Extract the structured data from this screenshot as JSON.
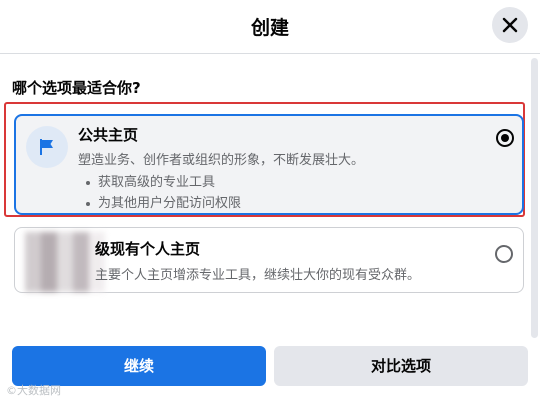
{
  "dialog": {
    "title": "创建",
    "question": "哪个选项最适合你?"
  },
  "options": [
    {
      "title": "公共主页",
      "description": "塑造业务、创作者或组织的形象，不断发展壮大。",
      "bullets": [
        "获取高级的专业工具",
        "为其他用户分配访问权限"
      ],
      "selected": true,
      "icon": "flag-icon"
    },
    {
      "title": "级现有个人主页",
      "description": "主要个人主页增添专业工具，继续壮大你的现有受众群。",
      "selected": false
    }
  ],
  "actions": {
    "continue_label": "继续",
    "compare_label": "对比选项"
  },
  "watermark": "©大数据网",
  "colors": {
    "primary": "#1b74e4",
    "highlight_border": "#d93838",
    "secondary_button": "#e4e6eb"
  }
}
